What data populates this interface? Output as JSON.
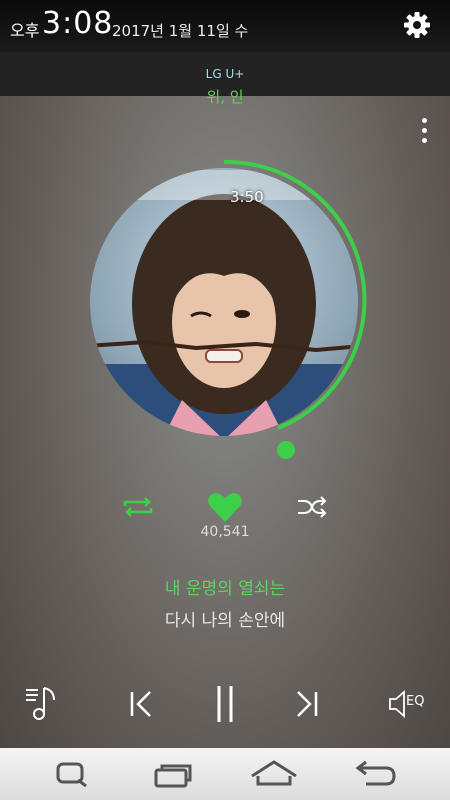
{
  "status_bar": {
    "ampm": "오후",
    "time": "3:08",
    "date": "2017년 1월 11일 수"
  },
  "carrier": "LG U+",
  "song_title_partial": "위, 인",
  "player": {
    "elapsed_time": "3:50",
    "like_count": "40,541",
    "lyrics": {
      "current": "내 운명의 열쇠는",
      "next": "다시 나의 손안에"
    },
    "eq_label": "EQ"
  },
  "colors": {
    "accent_green": "#3ecf4a",
    "carrier_text": "#9fe0e8"
  },
  "icons": {
    "settings": "gear-icon",
    "more": "more-vertical-icon",
    "repeat": "repeat-icon",
    "like": "heart-icon",
    "shuffle": "shuffle-icon",
    "playlist": "playlist-icon",
    "previous": "previous-track-icon",
    "pause": "pause-icon",
    "next": "next-track-icon",
    "equalizer": "speaker-eq-icon",
    "nav_search": "search-icon",
    "nav_recent": "recent-apps-icon",
    "nav_home": "home-icon",
    "nav_back": "back-icon"
  }
}
